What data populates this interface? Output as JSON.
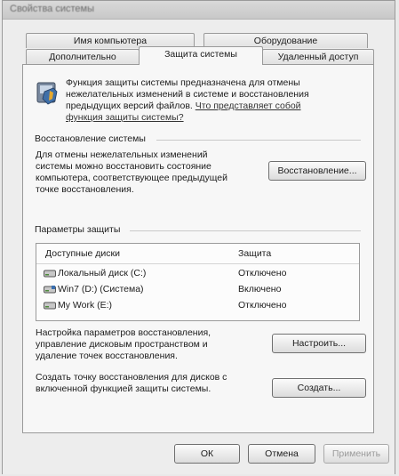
{
  "window": {
    "title": "Свойства системы"
  },
  "tabs": [
    {
      "label": "Имя компьютера"
    },
    {
      "label": "Оборудование"
    },
    {
      "label": "Дополнительно"
    },
    {
      "label": "Защита системы"
    },
    {
      "label": "Удаленный доступ"
    }
  ],
  "intro": {
    "line1": "Функция защиты системы предназначена для отмены",
    "line2": "нежелательных изменений в системе и восстановления",
    "line3_prefix": "предыдущих версий файлов.",
    "link_part1": "Что представляет собой",
    "link_part2": "функция защиты системы?",
    "icon": "shield-icon"
  },
  "restore_section": {
    "title": "Восстановление системы",
    "desc_lines": [
      "Для отмены нежелательных изменений",
      "системы можно восстановить состояние",
      "компьютера, соответствующее предыдущей",
      "точке восстановления."
    ],
    "button": "Восстановление..."
  },
  "protection_section": {
    "title": "Параметры защиты",
    "columns": [
      "Доступные диски",
      "Защита"
    ],
    "rows": [
      {
        "name": "Локальный диск (C:)",
        "status": "Отключено"
      },
      {
        "name": "Win7 (D:) (Система)",
        "status": "Включено"
      },
      {
        "name": "My Work (E:)",
        "status": "Отключено"
      }
    ]
  },
  "configure": {
    "desc_lines": [
      "Настройка параметров восстановления,",
      "управление дисковым пространством и",
      "удаление точек восстановления."
    ],
    "button": "Настроить..."
  },
  "create": {
    "desc_lines": [
      "Создать точку восстановления для дисков с",
      "включенной функцией защиты системы."
    ],
    "button": "Создать..."
  },
  "footer": {
    "ok": "ОК",
    "cancel": "Отмена",
    "apply": "Применить"
  }
}
